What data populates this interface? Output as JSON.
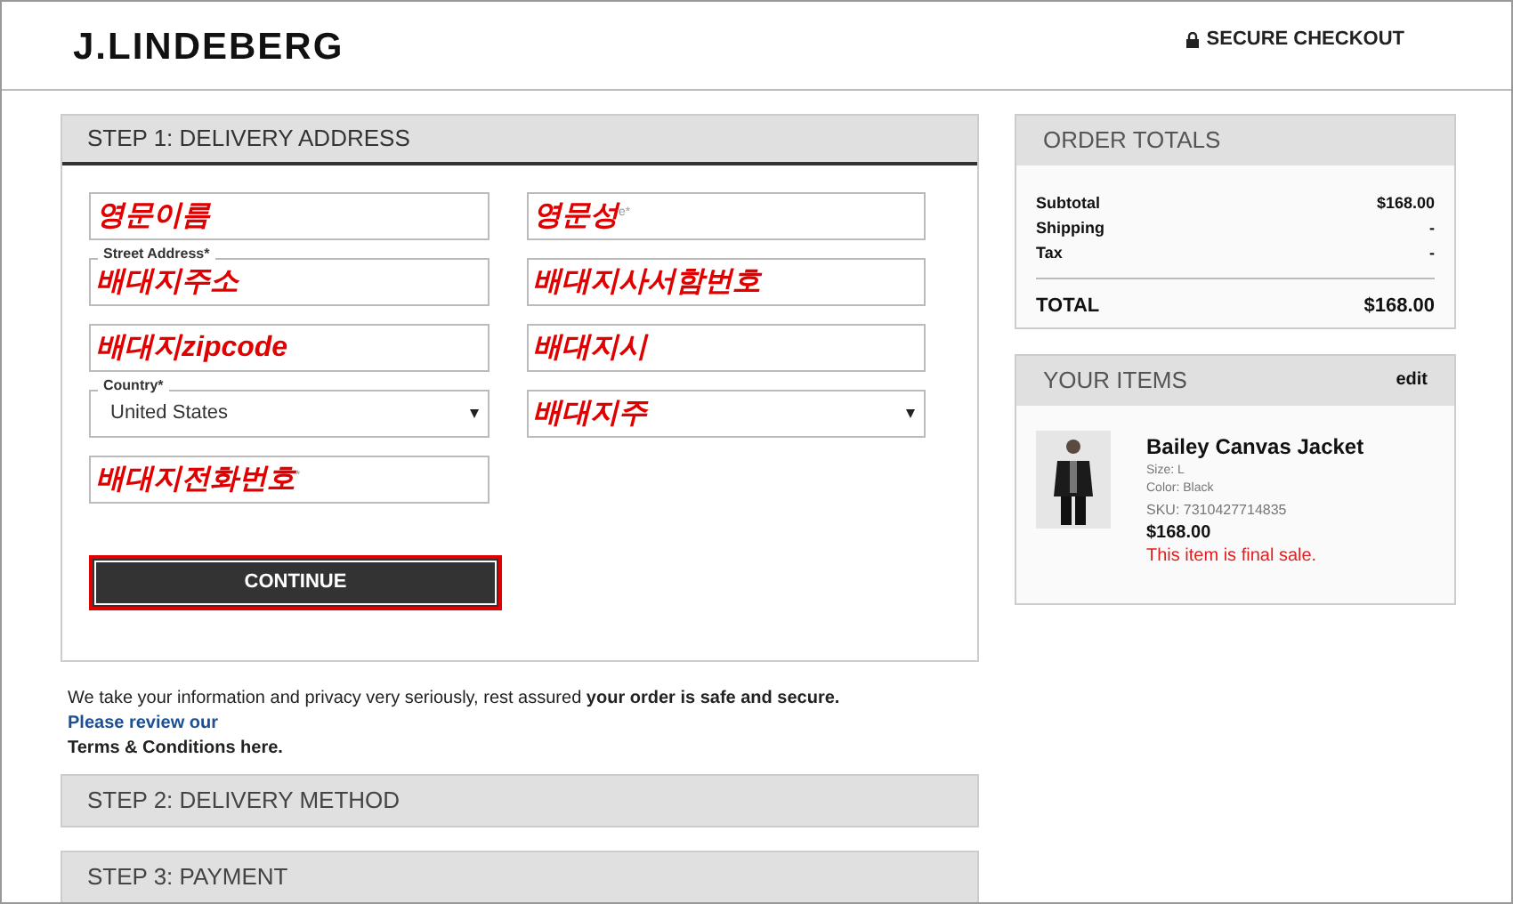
{
  "header": {
    "logo": "J.LINDEBERG",
    "secure": "SECURE CHECKOUT"
  },
  "step1": {
    "title": "STEP 1: DELIVERY ADDRESS",
    "fields": [
      {
        "kind": "input",
        "value": "영문이름"
      },
      {
        "kind": "input",
        "value": "영문성",
        "remnant": "e*"
      },
      {
        "kind": "input",
        "label": "Street Address*",
        "value": "배대지주소"
      },
      {
        "kind": "input",
        "value": "배대지사서함번호"
      },
      {
        "kind": "input",
        "value": "배대지zipcode"
      },
      {
        "kind": "input",
        "value": "배대지시"
      },
      {
        "kind": "typed-select",
        "label": "Country*",
        "value": "United States"
      },
      {
        "kind": "select",
        "value": "배대지주"
      },
      {
        "kind": "input",
        "value": "배대지전화번호",
        "remnant": "*"
      }
    ],
    "button": "CONTINUE"
  },
  "privacy": "We take your information and privacy very seriously, rest assured **your order is safe and secure.**",
  "privacy_link": "Please review our",
  "terms": "Terms & Conditions here.",
  "steps": [
    "STEP 2: DELIVERY METHOD",
    "STEP 3: PAYMENT"
  ],
  "order_totals": {
    "title": "ORDER TOTALS",
    "rows": [
      {
        "label": "Subtotal",
        "value": "$168.00"
      },
      {
        "label": "Shipping",
        "value": "-"
      },
      {
        "label": "Tax",
        "value": "-"
      }
    ],
    "total_label": "TOTAL",
    "total": "$168.00"
  },
  "items": {
    "title": "YOUR ITEMS",
    "edit": "edit",
    "list": [
      {
        "kind": "picture",
        "name": "Bailey Canvas Jacket",
        "size": "Size: L",
        "color_label": "Color: Black",
        "sku": "SKU: 7310427714835",
        "price": "$168.00",
        "note": "This item is final sale."
      }
    ]
  }
}
